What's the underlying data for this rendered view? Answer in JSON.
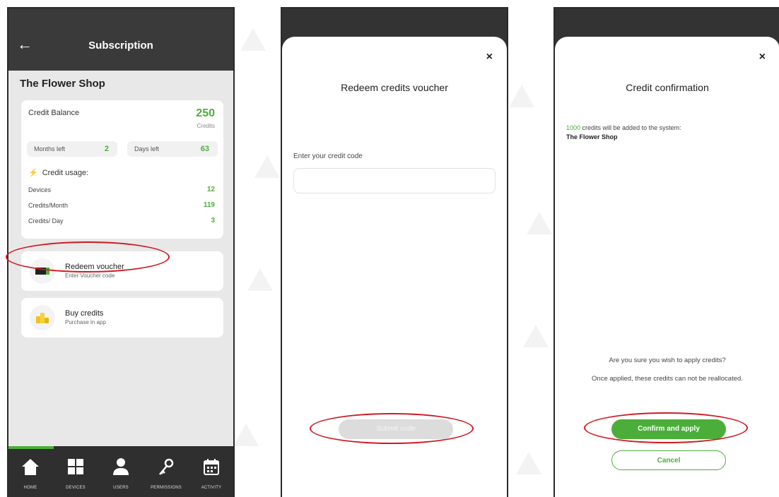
{
  "screen1": {
    "title": "Subscription",
    "back_icon": "arrow-left-icon",
    "shop_name": "The Flower Shop",
    "balance": {
      "label": "Credit Balance",
      "value": "250",
      "unit": "Credits",
      "months_label": "Months left",
      "months_value": "2",
      "days_label": "Days left",
      "days_value": "63"
    },
    "usage": {
      "heading": "Credit usage:",
      "rows": [
        {
          "label": "Devices",
          "value": "12"
        },
        {
          "label": "Credits/Month",
          "value": "119"
        },
        {
          "label": "Credits/ Day",
          "value": "3"
        }
      ]
    },
    "redeem": {
      "title": "Redeem voucher",
      "subtitle": "Enter Voucher code"
    },
    "buy": {
      "title": "Buy credits",
      "subtitle": "Purchase in app"
    },
    "tabs": [
      {
        "label": "HOME",
        "icon": "home-icon"
      },
      {
        "label": "DEVICES",
        "icon": "grid-icon"
      },
      {
        "label": "USERS",
        "icon": "user-icon"
      },
      {
        "label": "PERMISSIONS",
        "icon": "key-icon"
      },
      {
        "label": "ACTIVITY",
        "icon": "calendar-icon"
      }
    ]
  },
  "screen2": {
    "close": "×",
    "title": "Redeem credits voucher",
    "input_label": "Enter your credit code",
    "input_value": "",
    "submit_label": "Submit code"
  },
  "screen3": {
    "close": "×",
    "title": "Credit confirmation",
    "credits_amount": "1000",
    "credits_text": " credits will be added to the system:",
    "shop_name": "The Flower Shop",
    "question": "Are you sure you wish to apply credits?",
    "warning": "Once applied, these credits can not be reallocated.",
    "confirm_label": "Confirm and apply",
    "cancel_label": "Cancel"
  },
  "colors": {
    "accent": "#4cae3a",
    "annotation": "#d01c24",
    "dark": "#3a3a3a"
  }
}
